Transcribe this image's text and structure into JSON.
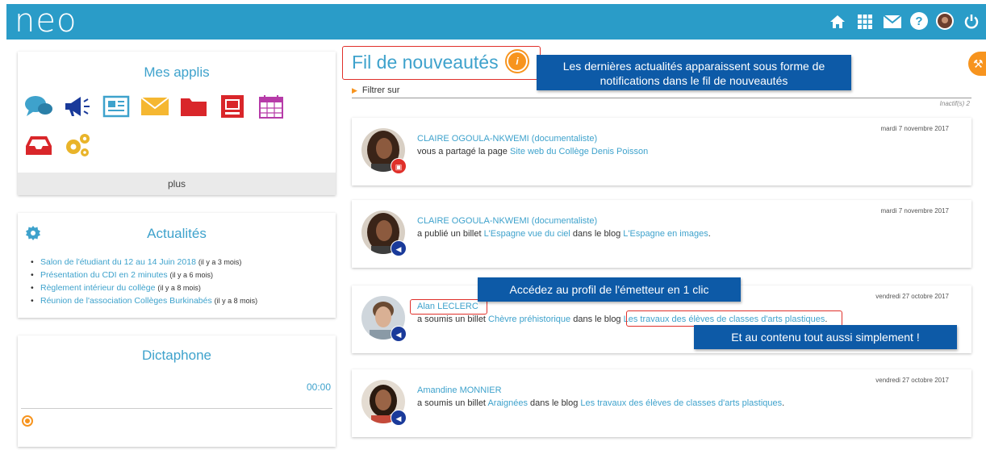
{
  "header": {
    "logo": "neo",
    "icons": [
      "home-icon",
      "apps-grid-icon",
      "mail-icon",
      "help-icon",
      "user-avatar",
      "power-icon"
    ]
  },
  "apps_panel": {
    "title": "Mes applis",
    "icons": [
      "chat-icon",
      "megaphone-icon",
      "newspaper-icon",
      "envelope-icon",
      "folder-icon",
      "pages-icon",
      "calendar-icon",
      "inbox-icon",
      "gears-icon"
    ],
    "more_label": "plus"
  },
  "news_panel": {
    "title": "Actualités",
    "items": [
      {
        "title": "Salon de l'étudiant du 12 au 14 Juin 2018",
        "ago": "(il y a 3 mois)"
      },
      {
        "title": "Présentation du CDI en 2 minutes",
        "ago": "(il y a 6 mois)"
      },
      {
        "title": "Règlement intérieur du collège",
        "ago": "(il y a 8 mois)"
      },
      {
        "title": "Réunion de l'association Collèges Burkinabés",
        "ago": "(il y a 8 mois)"
      }
    ]
  },
  "dictaphone": {
    "title": "Dictaphone",
    "time": "00:00"
  },
  "feed": {
    "title": "Fil de nouveautés",
    "info": "i",
    "filter_label": "Filtrer sur",
    "inactive_label": "Inactif(s) 2",
    "tooltips": {
      "tip1": "Les dernières actualités apparaissent sous forme de notifications dans le fil de nouveautés",
      "tip2": "Accédez au profil de l'émetteur en 1 clic",
      "tip3": "Et au contenu tout aussi simplement !"
    },
    "cards": [
      {
        "author": "CLAIRE OGOULA-NKWEMI (documentaliste)",
        "date": "mardi 7 novembre 2017",
        "pre": "vous a partagé la page ",
        "link1": "Site web du Collège Denis Poisson",
        "mid": "",
        "link2": "",
        "post": "",
        "badge_color": "#e0302a",
        "badge_icon": "page-icon"
      },
      {
        "author": "CLAIRE OGOULA-NKWEMI (documentaliste)",
        "date": "mardi 7 novembre 2017",
        "pre": "a publié un billet ",
        "link1": "L'Espagne vue du ciel",
        "mid": " dans le blog ",
        "link2": "L'Espagne en images",
        "post": ".",
        "badge_color": "#1a3a9a",
        "badge_icon": "megaphone-icon"
      },
      {
        "author": "Alan LECLERC",
        "date": "vendredi 27 octobre 2017",
        "pre": "a soumis un billet ",
        "link1": "Chèvre préhistorique",
        "mid": " dans le blog ",
        "link2": "Les travaux des élèves de classes d'arts plastiques",
        "post": ".",
        "badge_color": "#1a3a9a",
        "badge_icon": "megaphone-icon"
      },
      {
        "author": "Amandine MONNIER",
        "date": "vendredi 27 octobre 2017",
        "pre": "a soumis un billet ",
        "link1": "Araignées",
        "mid": " dans le blog ",
        "link2": "Les travaux des élèves de classes d'arts plastiques",
        "post": ".",
        "badge_color": "#1a3a9a",
        "badge_icon": "megaphone-icon"
      }
    ]
  }
}
